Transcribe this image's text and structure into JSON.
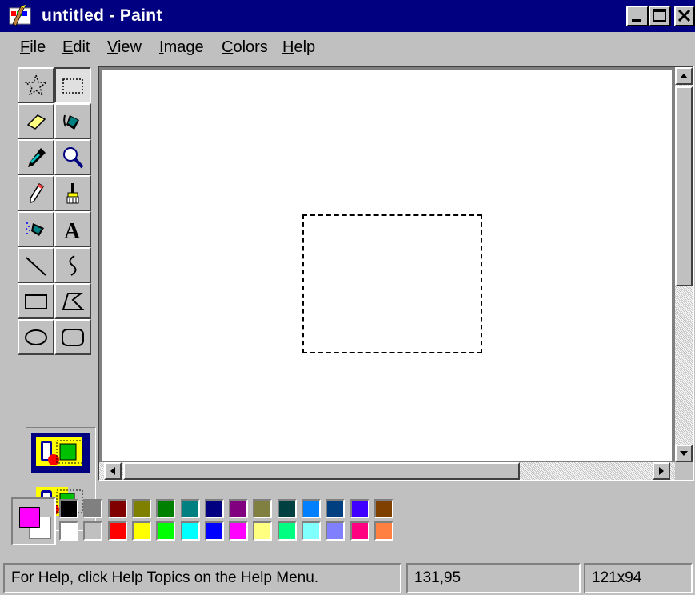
{
  "window": {
    "title": "untitled - Paint",
    "controls": [
      "minimize",
      "maximize",
      "close"
    ]
  },
  "menu": [
    {
      "label": "File",
      "accel": "F",
      "rest": "ile"
    },
    {
      "label": "Edit",
      "accel": "E",
      "rest": "dit"
    },
    {
      "label": "View",
      "accel": "V",
      "rest": "iew"
    },
    {
      "label": "Image",
      "accel": "I",
      "rest": "mage"
    },
    {
      "label": "Colors",
      "accel": "C",
      "rest": "olors"
    },
    {
      "label": "Help",
      "accel": "H",
      "rest": "elp"
    }
  ],
  "tools": [
    {
      "name": "free-form-select",
      "icon": "star-select-icon",
      "pressed": false
    },
    {
      "name": "select",
      "icon": "rect-select-icon",
      "pressed": true
    },
    {
      "name": "eraser",
      "icon": "eraser-icon",
      "pressed": false
    },
    {
      "name": "fill",
      "icon": "paint-bucket-icon",
      "pressed": false
    },
    {
      "name": "pick-color",
      "icon": "eyedropper-icon",
      "pressed": false
    },
    {
      "name": "magnifier",
      "icon": "magnifier-icon",
      "pressed": false
    },
    {
      "name": "pencil",
      "icon": "pencil-icon",
      "pressed": false
    },
    {
      "name": "brush",
      "icon": "brush-icon",
      "pressed": false
    },
    {
      "name": "airbrush",
      "icon": "airbrush-icon",
      "pressed": false
    },
    {
      "name": "text",
      "icon": "text-icon",
      "pressed": false
    },
    {
      "name": "line",
      "icon": "line-icon",
      "pressed": false
    },
    {
      "name": "curve",
      "icon": "curve-icon",
      "pressed": false
    },
    {
      "name": "rectangle",
      "icon": "rectangle-icon",
      "pressed": false
    },
    {
      "name": "polygon",
      "icon": "polygon-icon",
      "pressed": false
    },
    {
      "name": "ellipse",
      "icon": "ellipse-icon",
      "pressed": false
    },
    {
      "name": "rounded-rectangle",
      "icon": "rounded-rect-icon",
      "pressed": false
    }
  ],
  "tool_options": [
    {
      "name": "opaque-background",
      "icon": "opaque-selection-icon",
      "selected": true
    },
    {
      "name": "transparent-background",
      "icon": "transparent-selection-icon",
      "selected": false
    }
  ],
  "colors": {
    "foreground": "#ff00ff",
    "background": "#ffffff",
    "palette_top": [
      "#000000",
      "#808080",
      "#800000",
      "#808000",
      "#008000",
      "#008080",
      "#000080",
      "#800080",
      "#808040",
      "#004040",
      "#0080ff",
      "#004080",
      "#4000ff",
      "#804000"
    ],
    "palette_bottom": [
      "#ffffff",
      "#c0c0c0",
      "#ff0000",
      "#ffff00",
      "#00ff00",
      "#00ffff",
      "#0000ff",
      "#ff00ff",
      "#ffff80",
      "#00ff80",
      "#80ffff",
      "#8080ff",
      "#ff0080",
      "#ff8040"
    ]
  },
  "status": {
    "help": "For Help, click Help Topics on the Help Menu.",
    "coords": "131,95",
    "size": "121x94"
  }
}
